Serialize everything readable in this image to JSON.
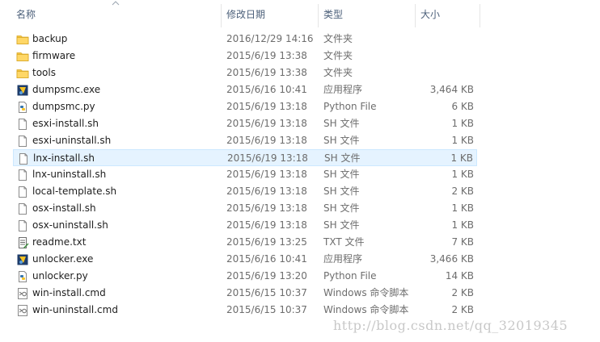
{
  "header": {
    "name": "名称",
    "date": "修改日期",
    "type": "类型",
    "size": "大小"
  },
  "rows": [
    {
      "name": "backup",
      "date": "2016/12/29 14:16",
      "type": "文件夹",
      "size": "",
      "icon": "folder-icon"
    },
    {
      "name": "firmware",
      "date": "2015/6/19 13:38",
      "type": "文件夹",
      "size": "",
      "icon": "folder-icon"
    },
    {
      "name": "tools",
      "date": "2015/6/19 13:38",
      "type": "文件夹",
      "size": "",
      "icon": "folder-icon"
    },
    {
      "name": "dumpsmc.exe",
      "date": "2015/6/16 10:41",
      "type": "应用程序",
      "size": "3,464 KB",
      "icon": "exe-icon"
    },
    {
      "name": "dumpsmc.py",
      "date": "2015/6/19 13:18",
      "type": "Python File",
      "size": "6 KB",
      "icon": "python-icon"
    },
    {
      "name": "esxi-install.sh",
      "date": "2015/6/19 13:18",
      "type": "SH 文件",
      "size": "1 KB",
      "icon": "file-icon"
    },
    {
      "name": "esxi-uninstall.sh",
      "date": "2015/6/19 13:18",
      "type": "SH 文件",
      "size": "1 KB",
      "icon": "file-icon"
    },
    {
      "name": "lnx-install.sh",
      "date": "2015/6/19 13:18",
      "type": "SH 文件",
      "size": "1 KB",
      "icon": "file-icon",
      "selected": true
    },
    {
      "name": "lnx-uninstall.sh",
      "date": "2015/6/19 13:18",
      "type": "SH 文件",
      "size": "1 KB",
      "icon": "file-icon"
    },
    {
      "name": "local-template.sh",
      "date": "2015/6/19 13:18",
      "type": "SH 文件",
      "size": "2 KB",
      "icon": "file-icon"
    },
    {
      "name": "osx-install.sh",
      "date": "2015/6/19 13:18",
      "type": "SH 文件",
      "size": "1 KB",
      "icon": "file-icon"
    },
    {
      "name": "osx-uninstall.sh",
      "date": "2015/6/19 13:18",
      "type": "SH 文件",
      "size": "1 KB",
      "icon": "file-icon"
    },
    {
      "name": "readme.txt",
      "date": "2015/6/19 13:25",
      "type": "TXT 文件",
      "size": "7 KB",
      "icon": "txt-icon"
    },
    {
      "name": "unlocker.exe",
      "date": "2015/6/16 10:41",
      "type": "应用程序",
      "size": "3,466 KB",
      "icon": "exe-icon"
    },
    {
      "name": "unlocker.py",
      "date": "2015/6/19 13:20",
      "type": "Python File",
      "size": "14 KB",
      "icon": "python-icon"
    },
    {
      "name": "win-install.cmd",
      "date": "2015/6/15 10:37",
      "type": "Windows 命令脚本",
      "size": "2 KB",
      "icon": "cmd-icon"
    },
    {
      "name": "win-uninstall.cmd",
      "date": "2015/6/15 10:37",
      "type": "Windows 命令脚本",
      "size": "2 KB",
      "icon": "cmd-icon"
    }
  ],
  "watermark": "http://blog.csdn.net/qq_32019345",
  "colors": {
    "selected_bg": "#e5f3ff",
    "folder": "#f4c542",
    "header_text": "#4c607a"
  }
}
